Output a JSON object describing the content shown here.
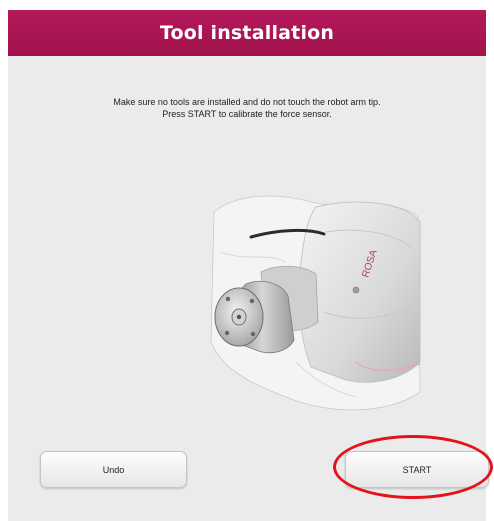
{
  "header": {
    "title": "Tool installation",
    "color": "#a8144f"
  },
  "instruction": {
    "line1": "Make sure no tools are installed and do not touch the robot arm tip.",
    "line2": "Press START to calibrate the force sensor."
  },
  "illustration": {
    "subject": "robot-arm-tip",
    "brand_text": "ROSA"
  },
  "buttons": {
    "undo_label": "Undo",
    "start_label": "START"
  },
  "annotation": {
    "highlight_color": "#e4121b"
  }
}
